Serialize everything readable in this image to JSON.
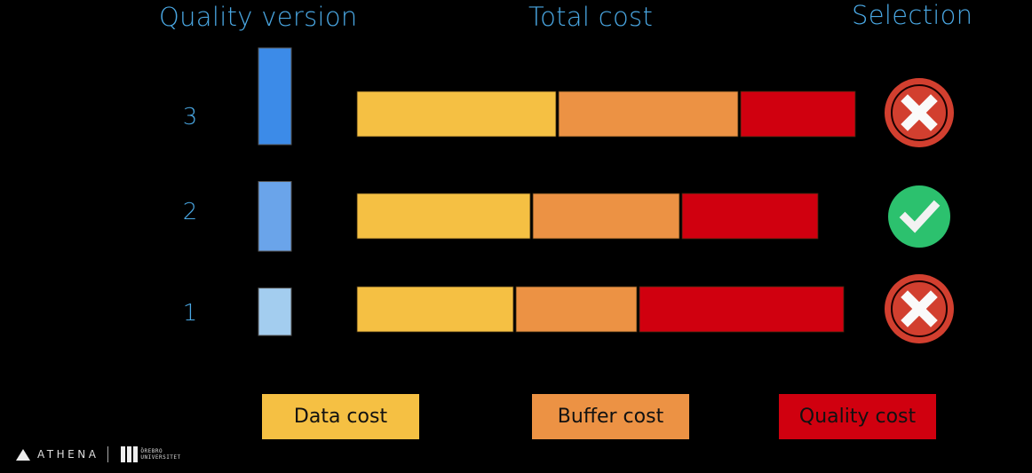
{
  "headers": {
    "quality_version": "Quality version",
    "total_cost": "Total cost",
    "selection": "Selection"
  },
  "legend": {
    "data_cost": "Data cost",
    "buffer_cost": "Buffer cost",
    "quality_cost": "Quality cost"
  },
  "colors": {
    "header_text": "#4aa8e4",
    "data_cost": "#f5c043",
    "buffer_cost": "#ec9244",
    "quality_cost": "#d0000f",
    "selected": "#2cc16e",
    "rejected": "#d23f2f",
    "quality_bar_3": "#3c8be8",
    "quality_bar_2": "#6aa4ea",
    "quality_bar_1": "#a3cdef"
  },
  "footer": {
    "brand": "ATHENA",
    "university_line1": "ÖREBRO",
    "university_line2": "UNIVERSITET"
  },
  "chart_data": {
    "type": "bar",
    "orientation": "horizontal-stacked",
    "title": "",
    "xlabel": "Total cost",
    "ylabel": "Quality version",
    "units": "relative (no axis shown)",
    "categories": [
      "3",
      "2",
      "1"
    ],
    "quality_level": [
      100,
      72,
      49
    ],
    "series": [
      {
        "name": "Data cost",
        "values": [
          224,
          195,
          176
        ]
      },
      {
        "name": "Buffer cost",
        "values": [
          202,
          165,
          136
        ]
      },
      {
        "name": "Quality cost",
        "values": [
          129,
          153,
          230
        ]
      }
    ],
    "totals": [
      555,
      513,
      542
    ],
    "selection": [
      "rejected",
      "selected",
      "rejected"
    ],
    "legend_position": "bottom",
    "grid": false
  }
}
